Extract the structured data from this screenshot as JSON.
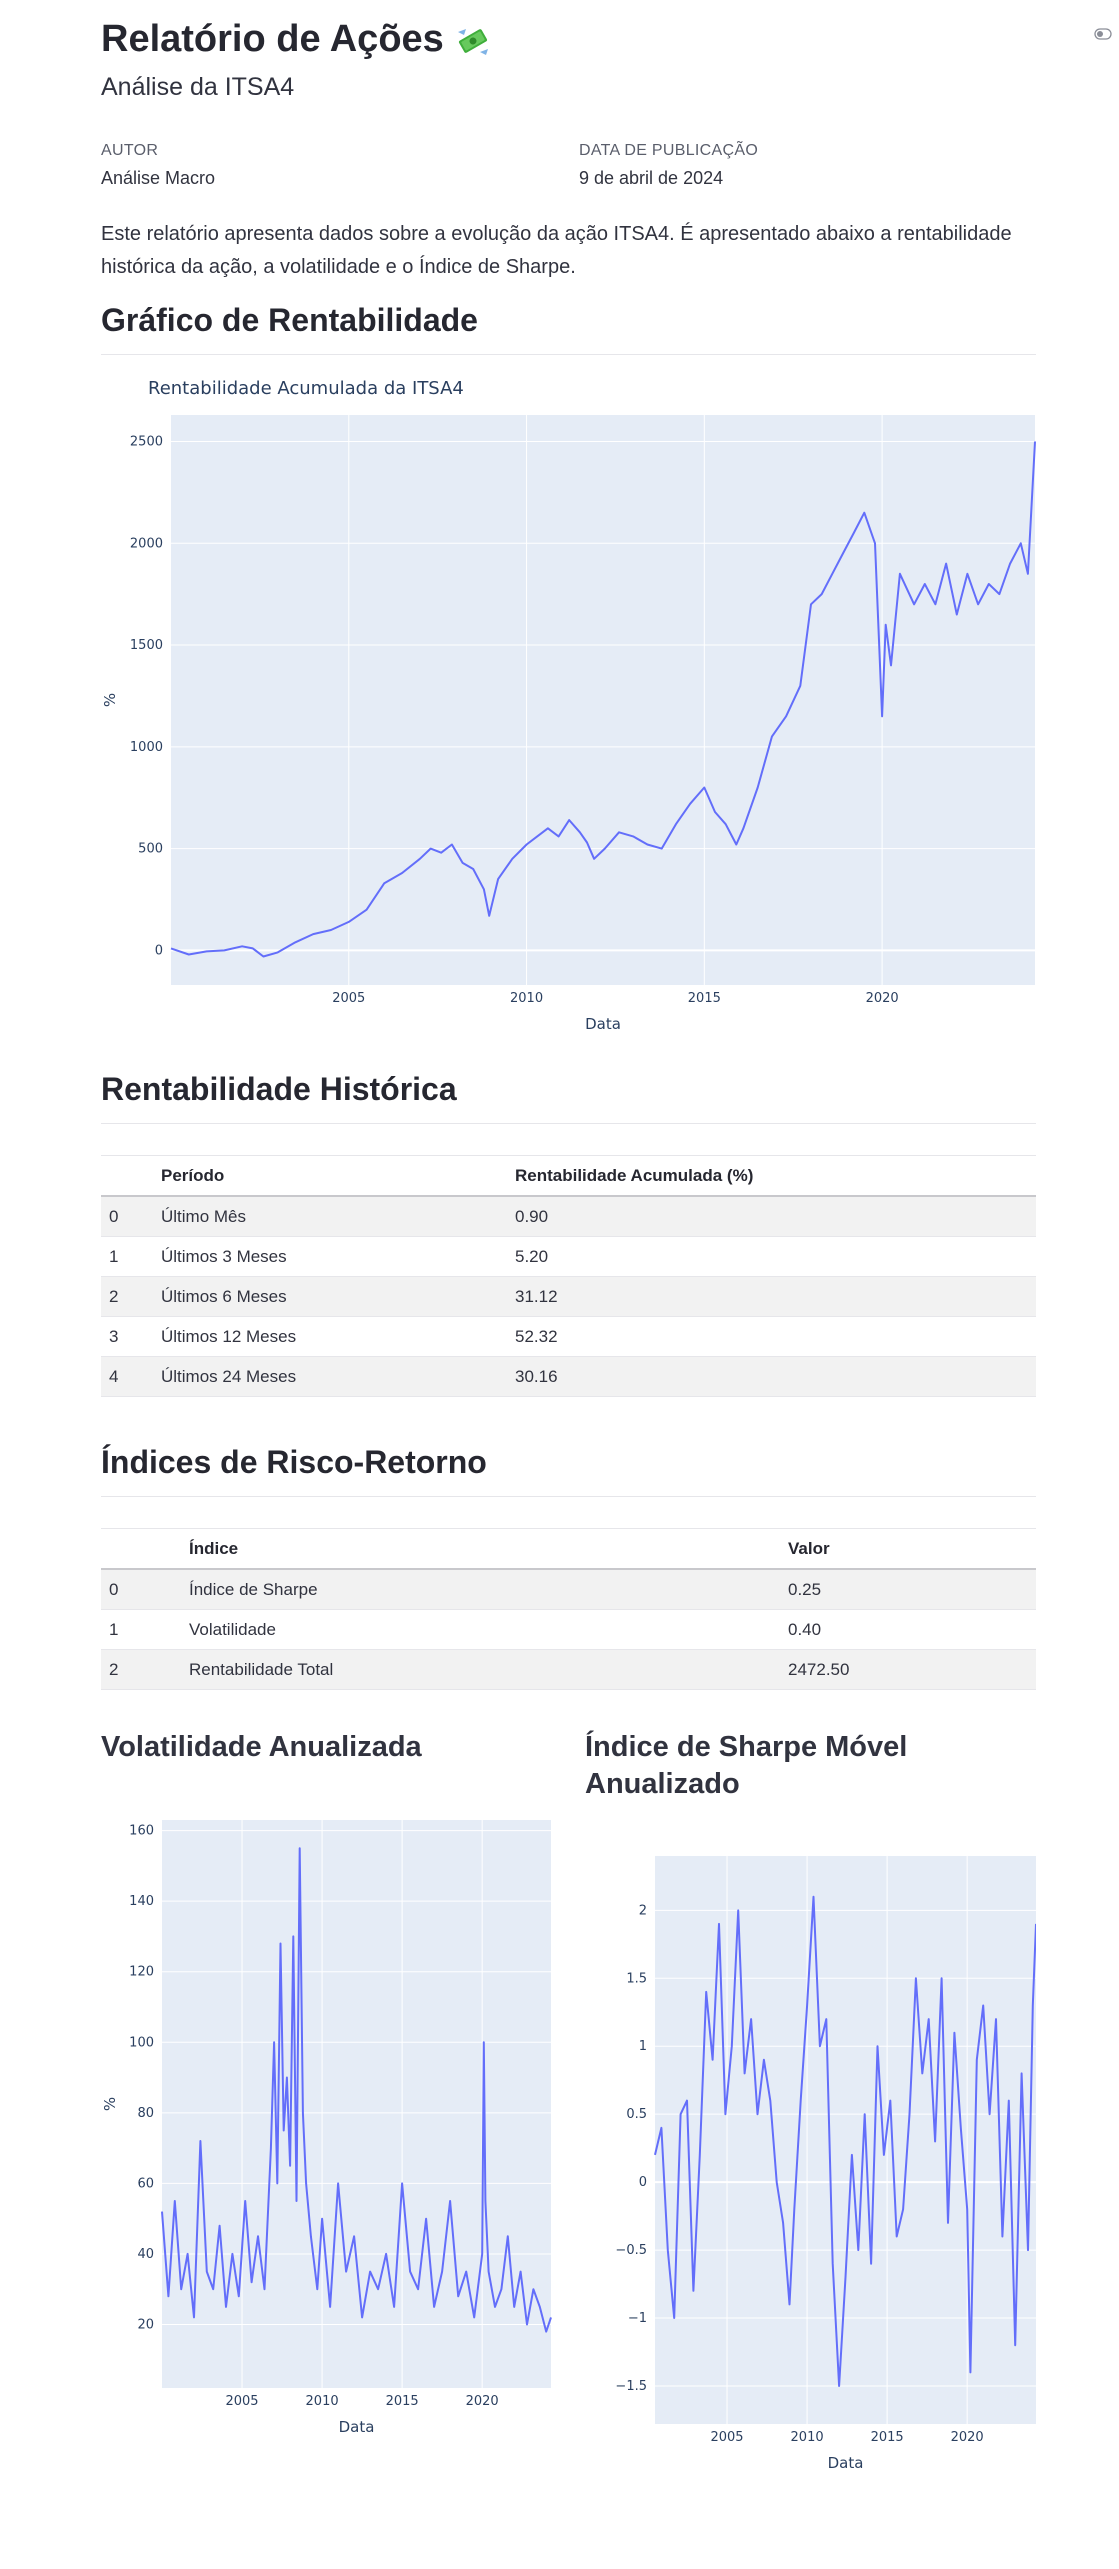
{
  "header": {
    "title": "Relatório de Ações",
    "subtitle": "Análise da ITSA4",
    "author_label": "AUTOR",
    "author_value": "Análise Macro",
    "date_label": "DATA DE PUBLICAÇÃO",
    "date_value": "9 de abril de 2024",
    "intro": "Este relatório apresenta dados sobre a evolução da ação ITSA4. É apresentado abaixo a rentabilidade histórica da ação, a volatilidade e o Índice de Sharpe."
  },
  "sections": {
    "return_chart": "Gráfico de Rentabilidade",
    "historical": "Rentabilidade Histórica",
    "risk": "Índices de Risco-Retorno",
    "volatility": "Volatilidade Anualizada",
    "sharpe": "Índice de Sharpe Móvel Anualizado"
  },
  "historical_table": {
    "columns": [
      "",
      "Período",
      "Rentabilidade Acumulada (%)"
    ],
    "rows": [
      [
        "0",
        "Último Mês",
        "0.90"
      ],
      [
        "1",
        "Últimos 3 Meses",
        "5.20"
      ],
      [
        "2",
        "Últimos 6 Meses",
        "31.12"
      ],
      [
        "3",
        "Últimos 12 Meses",
        "52.32"
      ],
      [
        "4",
        "Últimos 24 Meses",
        "30.16"
      ]
    ]
  },
  "risk_table": {
    "columns": [
      "",
      "Índice",
      "Valor"
    ],
    "rows": [
      [
        "0",
        "Índice de Sharpe",
        "0.25"
      ],
      [
        "1",
        "Volatilidade",
        "0.40"
      ],
      [
        "2",
        "Rentabilidade Total",
        "2472.50"
      ]
    ]
  },
  "colors": {
    "line": "#636efa",
    "plot_bg": "#e5ecf6",
    "grid": "#ffffff",
    "axis_text": "#2a3f5f"
  },
  "chart_data": [
    {
      "type": "line",
      "title": "Rentabilidade Acumulada da ITSA4",
      "xlabel": "Data",
      "ylabel": "%",
      "xlim": [
        2000,
        2024.3
      ],
      "ylim": [
        -170,
        2630
      ],
      "xticks": [
        2005,
        2010,
        2015,
        2020
      ],
      "yticks": [
        0,
        500,
        1000,
        1500,
        2000,
        2500
      ],
      "x": [
        2000.0,
        2000.5,
        2001.0,
        2001.5,
        2002.0,
        2002.3,
        2002.6,
        2003.0,
        2003.5,
        2004.0,
        2004.5,
        2005.0,
        2005.5,
        2006.0,
        2006.5,
        2007.0,
        2007.3,
        2007.6,
        2007.9,
        2008.2,
        2008.5,
        2008.8,
        2008.95,
        2009.2,
        2009.6,
        2010.0,
        2010.3,
        2010.6,
        2010.9,
        2011.2,
        2011.5,
        2011.7,
        2011.9,
        2012.2,
        2012.6,
        2013.0,
        2013.4,
        2013.8,
        2014.2,
        2014.6,
        2015.0,
        2015.3,
        2015.6,
        2015.9,
        2016.1,
        2016.5,
        2016.9,
        2017.3,
        2017.7,
        2018.0,
        2018.3,
        2018.6,
        2018.9,
        2019.2,
        2019.5,
        2019.8,
        2020.0,
        2020.1,
        2020.25,
        2020.5,
        2020.9,
        2021.2,
        2021.5,
        2021.8,
        2022.1,
        2022.4,
        2022.7,
        2023.0,
        2023.3,
        2023.6,
        2023.9,
        2024.1,
        2024.3
      ],
      "y": [
        10,
        -20,
        -5,
        0,
        20,
        10,
        -30,
        -10,
        40,
        80,
        100,
        140,
        200,
        330,
        380,
        450,
        500,
        480,
        520,
        430,
        400,
        300,
        170,
        350,
        450,
        520,
        560,
        600,
        560,
        640,
        580,
        530,
        450,
        500,
        580,
        560,
        520,
        500,
        620,
        720,
        800,
        680,
        620,
        520,
        600,
        800,
        1050,
        1150,
        1300,
        1700,
        1750,
        1850,
        1950,
        2050,
        2150,
        2000,
        1150,
        1600,
        1400,
        1850,
        1700,
        1800,
        1700,
        1900,
        1650,
        1850,
        1700,
        1800,
        1750,
        1900,
        2000,
        1850,
        2500
      ]
    },
    {
      "type": "line",
      "title": "",
      "xlabel": "Data",
      "ylabel": "%",
      "xlim": [
        2000,
        2024.3
      ],
      "ylim": [
        2,
        163
      ],
      "xticks": [
        2005,
        2010,
        2015,
        2020
      ],
      "yticks": [
        20,
        40,
        60,
        80,
        100,
        120,
        140,
        160
      ],
      "x": [
        2000.0,
        2000.4,
        2000.8,
        2001.2,
        2001.6,
        2002.0,
        2002.4,
        2002.8,
        2003.2,
        2003.6,
        2004.0,
        2004.4,
        2004.8,
        2005.2,
        2005.6,
        2006.0,
        2006.4,
        2006.8,
        2007.0,
        2007.2,
        2007.4,
        2007.6,
        2007.8,
        2008.0,
        2008.2,
        2008.4,
        2008.6,
        2008.8,
        2009.0,
        2009.3,
        2009.7,
        2010.0,
        2010.5,
        2011.0,
        2011.5,
        2012.0,
        2012.5,
        2013.0,
        2013.5,
        2014.0,
        2014.5,
        2015.0,
        2015.5,
        2016.0,
        2016.5,
        2017.0,
        2017.5,
        2018.0,
        2018.5,
        2019.0,
        2019.5,
        2020.0,
        2020.1,
        2020.2,
        2020.4,
        2020.8,
        2021.2,
        2021.6,
        2022.0,
        2022.4,
        2022.8,
        2023.2,
        2023.6,
        2024.0,
        2024.3
      ],
      "y": [
        52,
        28,
        55,
        30,
        40,
        22,
        72,
        35,
        30,
        48,
        25,
        40,
        28,
        55,
        32,
        45,
        30,
        70,
        100,
        60,
        128,
        75,
        90,
        65,
        130,
        55,
        155,
        80,
        60,
        45,
        30,
        50,
        25,
        60,
        35,
        45,
        22,
        35,
        30,
        40,
        25,
        60,
        35,
        30,
        50,
        25,
        35,
        55,
        28,
        35,
        22,
        40,
        100,
        55,
        35,
        25,
        30,
        45,
        25,
        35,
        20,
        30,
        25,
        18,
        22
      ]
    },
    {
      "type": "line",
      "title": "",
      "xlabel": "Data",
      "ylabel": "",
      "xlim": [
        2000.5,
        2024.3
      ],
      "ylim": [
        -1.78,
        2.4
      ],
      "xticks": [
        2005,
        2010,
        2015,
        2020
      ],
      "yticks": [
        -1.5,
        -1,
        -0.5,
        0,
        0.5,
        1,
        1.5,
        2
      ],
      "x": [
        2000.5,
        2000.9,
        2001.3,
        2001.7,
        2002.1,
        2002.5,
        2002.9,
        2003.3,
        2003.7,
        2004.1,
        2004.5,
        2004.9,
        2005.3,
        2005.7,
        2006.1,
        2006.5,
        2006.9,
        2007.3,
        2007.7,
        2008.1,
        2008.5,
        2008.9,
        2009.2,
        2009.6,
        2010.0,
        2010.4,
        2010.8,
        2011.2,
        2011.6,
        2012.0,
        2012.4,
        2012.8,
        2013.2,
        2013.6,
        2014.0,
        2014.4,
        2014.8,
        2015.2,
        2015.6,
        2016.0,
        2016.4,
        2016.8,
        2017.2,
        2017.6,
        2018.0,
        2018.4,
        2018.8,
        2019.2,
        2019.6,
        2020.0,
        2020.2,
        2020.6,
        2021.0,
        2021.4,
        2021.8,
        2022.2,
        2022.6,
        2023.0,
        2023.4,
        2023.8,
        2024.1,
        2024.3
      ],
      "y": [
        0.2,
        0.4,
        -0.5,
        -1.0,
        0.5,
        0.6,
        -0.8,
        0.2,
        1.4,
        0.9,
        1.9,
        0.5,
        1.0,
        2.0,
        0.8,
        1.2,
        0.5,
        0.9,
        0.6,
        0.0,
        -0.3,
        -0.9,
        -0.2,
        0.6,
        1.3,
        2.1,
        1.0,
        1.2,
        -0.6,
        -1.5,
        -0.7,
        0.2,
        -0.5,
        0.5,
        -0.6,
        1.0,
        0.2,
        0.6,
        -0.4,
        -0.2,
        0.5,
        1.5,
        0.8,
        1.2,
        0.3,
        1.5,
        -0.3,
        1.1,
        0.4,
        -0.2,
        -1.4,
        0.9,
        1.3,
        0.5,
        1.2,
        -0.4,
        0.6,
        -1.2,
        0.8,
        -0.5,
        1.3,
        1.9
      ]
    }
  ]
}
